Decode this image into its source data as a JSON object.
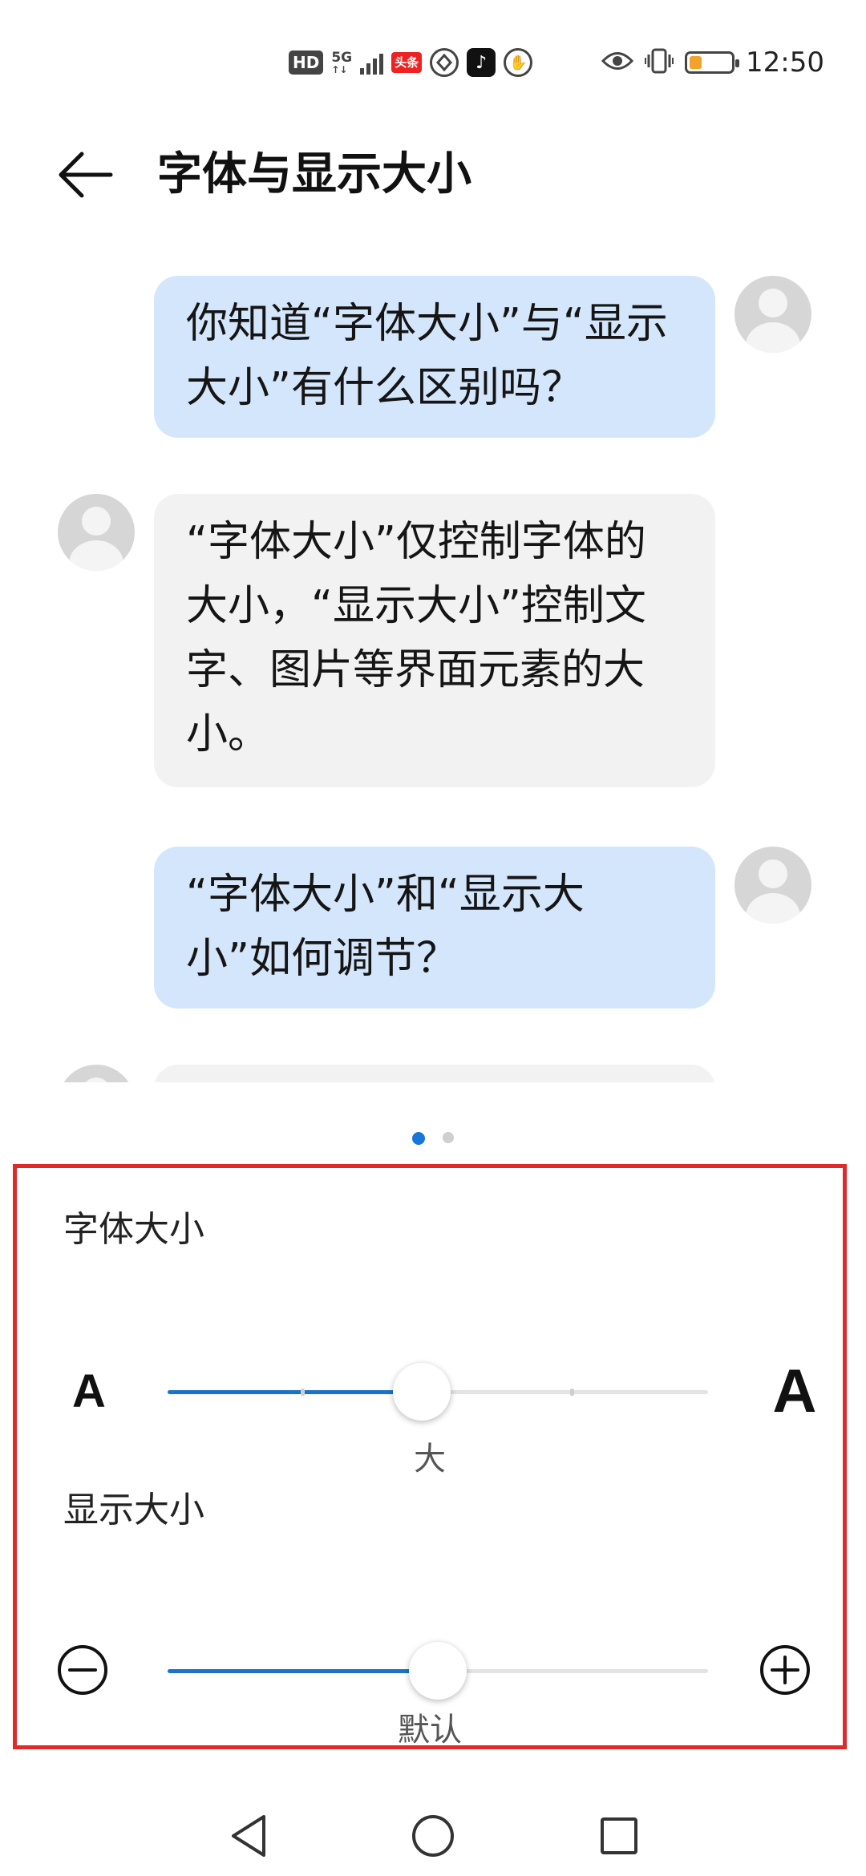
{
  "status_bar": {
    "hd": "HD",
    "network_top": "5G",
    "network_bottom": "↑↓",
    "toutiao": "头条",
    "tiktok_glyph": "♪",
    "hand_glyph": "✋",
    "time": "12:50",
    "battery_level": 0.3,
    "battery_color": "#f2a22a",
    "icons": [
      "hd-icon",
      "signal-icon",
      "toutiao-icon",
      "app-icon",
      "tiktok-icon",
      "hand-icon",
      "eye-icon",
      "vibrate-icon",
      "battery-icon"
    ]
  },
  "header": {
    "title": "字体与显示大小",
    "back_icon": "back-arrow-icon"
  },
  "chat": {
    "messages": [
      {
        "side": "me",
        "text": "你知道“字体大小”与“显示大小”有什么区别吗？"
      },
      {
        "side": "other",
        "text": "“字体大小”仅控制字体的大小，“显示大小”控制文字、图片等界面元素的大小。"
      },
      {
        "side": "me",
        "text": "“字体大小”和“显示大小”如何调节？"
      }
    ]
  },
  "pager": {
    "count": 2,
    "active_index": 0,
    "active_color": "#1877d6"
  },
  "settings": {
    "font_size": {
      "label": "字体大小",
      "min_glyph": "A",
      "max_glyph": "A",
      "value_label": "大",
      "level": 0.47
    },
    "display_size": {
      "label": "显示大小",
      "min_icon": "minus-circle-icon",
      "max_icon": "plus-circle-icon",
      "value_label": "默认",
      "level": 0.5
    },
    "accent_color": "#1a73c9",
    "highlight_border_color": "#e02a2a"
  },
  "nav_bar": {
    "buttons": [
      "back-triangle-icon",
      "home-circle-icon",
      "recents-square-icon"
    ]
  }
}
